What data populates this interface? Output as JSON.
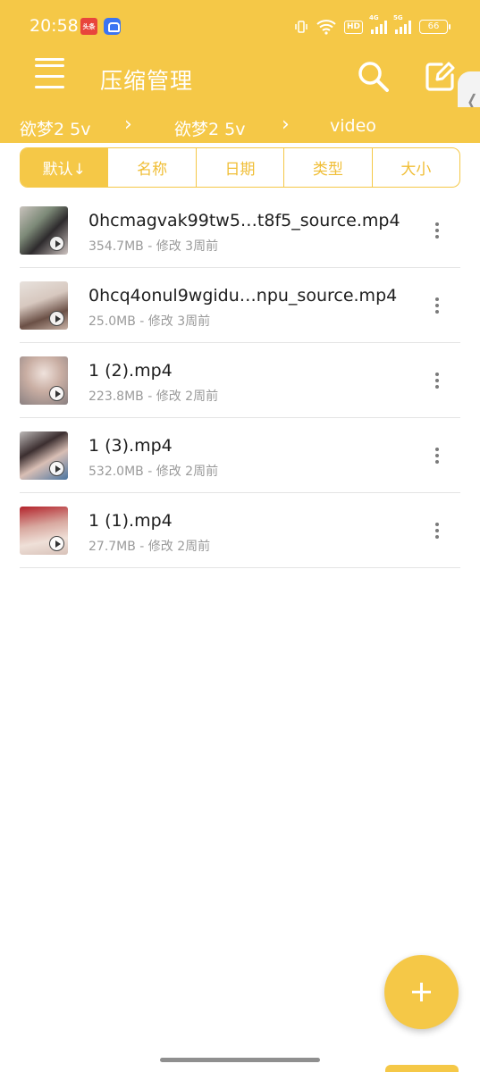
{
  "status_bar": {
    "time": "20:58",
    "app_badge_1": "头条",
    "network_4g": "4G",
    "network_5g": "5G",
    "hd_label": "HD",
    "battery": "66"
  },
  "app_bar": {
    "title": "压缩管理",
    "accent_color": "#f5c847"
  },
  "breadcrumb": {
    "items": [
      "欲梦2 5v",
      "欲梦2 5v",
      "video"
    ],
    "separator": "›"
  },
  "sort_tabs": [
    {
      "label": "默认↓",
      "active": true
    },
    {
      "label": "名称",
      "active": false
    },
    {
      "label": "日期",
      "active": false
    },
    {
      "label": "类型",
      "active": false
    },
    {
      "label": "大小",
      "active": false
    }
  ],
  "files": [
    {
      "name": "0hcmagvak99tw5…t8f5_source.mp4",
      "meta": "354.7MB - 修改 3周前",
      "thumb_icon": "video-thumbnail"
    },
    {
      "name": "0hcq4onul9wgidu…npu_source.mp4",
      "meta": "25.0MB - 修改 3周前",
      "thumb_icon": "video-thumbnail"
    },
    {
      "name": "1 (2).mp4",
      "meta": "223.8MB - 修改 2周前",
      "thumb_icon": "video-thumbnail"
    },
    {
      "name": "1 (3).mp4",
      "meta": "532.0MB - 修改 2周前",
      "thumb_icon": "video-thumbnail"
    },
    {
      "name": "1 (1).mp4",
      "meta": "27.7MB - 修改 2周前",
      "thumb_icon": "video-thumbnail"
    }
  ],
  "fab": {
    "icon": "plus-icon"
  }
}
